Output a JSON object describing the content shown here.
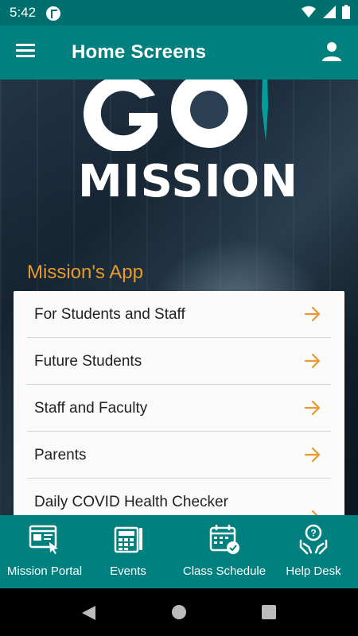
{
  "status_bar": {
    "time": "5:42",
    "icons": [
      "notification-p-icon",
      "wifi-icon",
      "signal-icon",
      "battery-icon"
    ]
  },
  "app_bar": {
    "title": "Home Screens",
    "menu_icon": "hamburger-menu-icon",
    "profile_icon": "person-icon"
  },
  "hero": {
    "logo_top": "GO",
    "logo_bottom": "MISSION"
  },
  "section": {
    "title": "Mission's App"
  },
  "list": {
    "items": [
      {
        "label": "For Students and Staff",
        "icon": "arrow-right-icon"
      },
      {
        "label": "Future Students",
        "icon": "arrow-right-icon"
      },
      {
        "label": "Staff and Faculty",
        "icon": "arrow-right-icon"
      },
      {
        "label": "Parents",
        "icon": "arrow-right-icon"
      },
      {
        "label": "Daily COVID Health Checker",
        "icon": "arrow-right-icon"
      }
    ]
  },
  "bottom_nav": {
    "items": [
      {
        "label": "Mission Portal",
        "icon": "portal-icon"
      },
      {
        "label": "Events",
        "icon": "calendar-grid-icon"
      },
      {
        "label": "Class Schedule",
        "icon": "schedule-calendar-icon"
      },
      {
        "label": "Help Desk",
        "icon": "help-hands-icon"
      }
    ]
  },
  "colors": {
    "primary": "#00807F",
    "status_bar": "#00706F",
    "accent": "#E89A2C",
    "card": "#FAFAFA"
  }
}
